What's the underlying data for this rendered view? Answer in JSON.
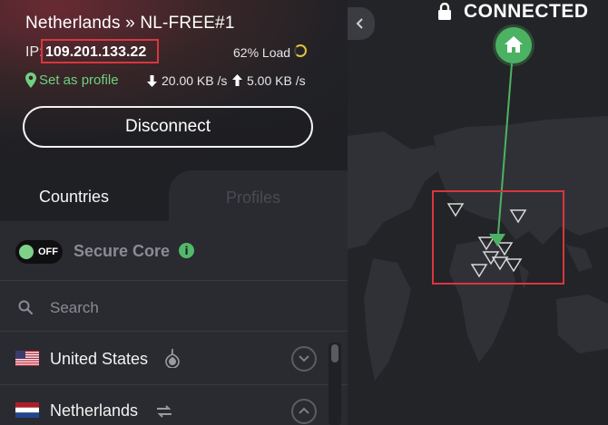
{
  "connection": {
    "server": "Netherlands » NL-FREE#1",
    "ip_label": "IP:",
    "ip": "109.201.133.22",
    "load": "62% Load",
    "set_profile": "Set as profile",
    "download": "20.00 KB /s",
    "upload": "5.00 KB /s",
    "disconnect_label": "Disconnect"
  },
  "tabs": {
    "countries": "Countries",
    "profiles": "Profiles"
  },
  "secure_core": {
    "toggle_label": "OFF",
    "label": "Secure Core"
  },
  "search": {
    "placeholder": "Search"
  },
  "countries": [
    {
      "name": "United States"
    },
    {
      "name": "Netherlands"
    }
  ],
  "map": {
    "status": "CONNECTED"
  },
  "colors": {
    "accent": "#4cb263",
    "highlight": "#d9363e"
  }
}
